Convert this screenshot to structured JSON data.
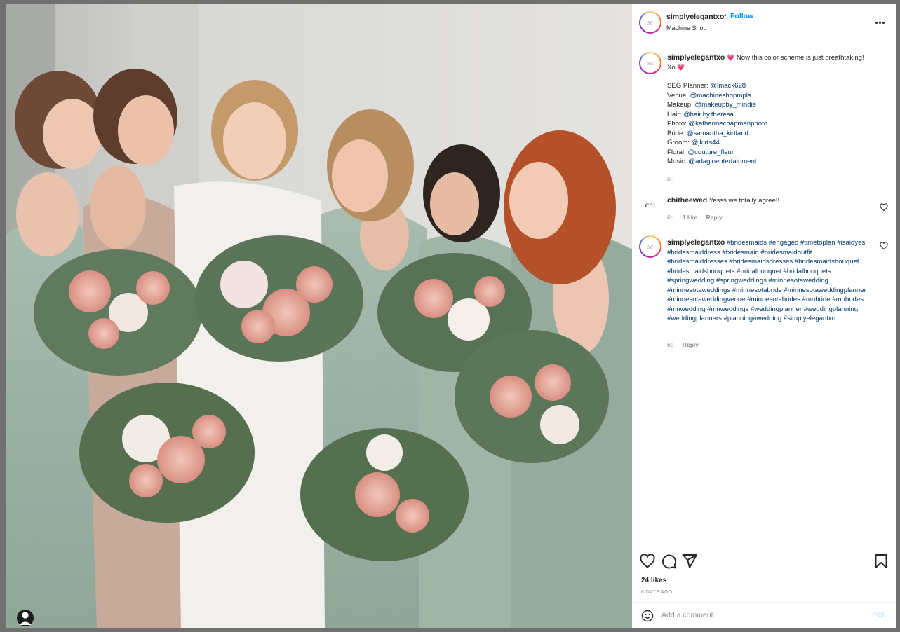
{
  "post": {
    "username": "simplyelegantxo",
    "dot": "•",
    "follow_label": "Follow",
    "location": "Machine Shop",
    "avatar_text": "se"
  },
  "caption": {
    "username": "simplyelegantxo",
    "heart": "💗",
    "text": "Now this color scheme is just breathtaking! Xo",
    "credits": [
      {
        "label": "SEG Planner:",
        "handle": "@lmack628"
      },
      {
        "label": "Venue:",
        "handle": "@machineshopmpls"
      },
      {
        "label": "Makeup:",
        "handle": "@makeupby_mindie"
      },
      {
        "label": "Hair:",
        "handle": "@hair.by.theresa"
      },
      {
        "label": "Photo:",
        "handle": "@katherinechapmanphoto"
      },
      {
        "label": "Bride:",
        "handle": "@samantha_kirtland"
      },
      {
        "label": "Groom:",
        "handle": "@jkirts44"
      },
      {
        "label": "Floral:",
        "handle": "@couture_fleur"
      },
      {
        "label": "Music:",
        "handle": "@adagioentertainment"
      }
    ],
    "time": "6d"
  },
  "comments": [
    {
      "username": "chitheewed",
      "avatar_text": "chi",
      "text": "Yesss we totally agree!!",
      "time": "6d",
      "likes": "1 like",
      "reply_label": "Reply"
    },
    {
      "username": "simplyelegantxo",
      "hashtags": [
        "#bridesmaids",
        "#engaged",
        "#timetoplan",
        "#isaidyes",
        "#bridesmaiddress",
        "#bridesmaid",
        "#bridesmaidoutfit",
        "#bridesmaiddresses",
        "#bridesmaidsdresses",
        "#bridesmaidsbouquet",
        "#bridesmaidsbouquets",
        "#bridalbouquet",
        "#bridalbouquets",
        "#springwedding",
        "#springweddings",
        "#minnesotawedding",
        "#minnesotaweddings",
        "#minnesotabride",
        "#minnesotaweddingplanner",
        "#minnesotaweddingvenue",
        "#minnesotabrides",
        "#mnbride",
        "#mnbrides",
        "#mnwedding",
        "#mnweddings",
        "#weddingplanner",
        "#weddingplanning",
        "#weddingplanners",
        "#planningawedding",
        "#simplyelegantxo"
      ],
      "time": "6d",
      "reply_label": "Reply"
    }
  ],
  "footer": {
    "likes": "24 likes",
    "date": "6 DAYS AGO",
    "comment_placeholder": "Add a comment...",
    "post_label": "Post"
  },
  "icons": {
    "like": "heart-icon",
    "comment": "comment-icon",
    "share": "send-icon",
    "save": "bookmark-icon",
    "emoji": "smiley-icon",
    "tag": "user-tag-icon",
    "more": "more-horizontal-icon"
  },
  "colors": {
    "follow": "#0095f6",
    "link": "#00376b",
    "muted": "#8e8e8e",
    "post_disabled": "#b2dffc"
  }
}
